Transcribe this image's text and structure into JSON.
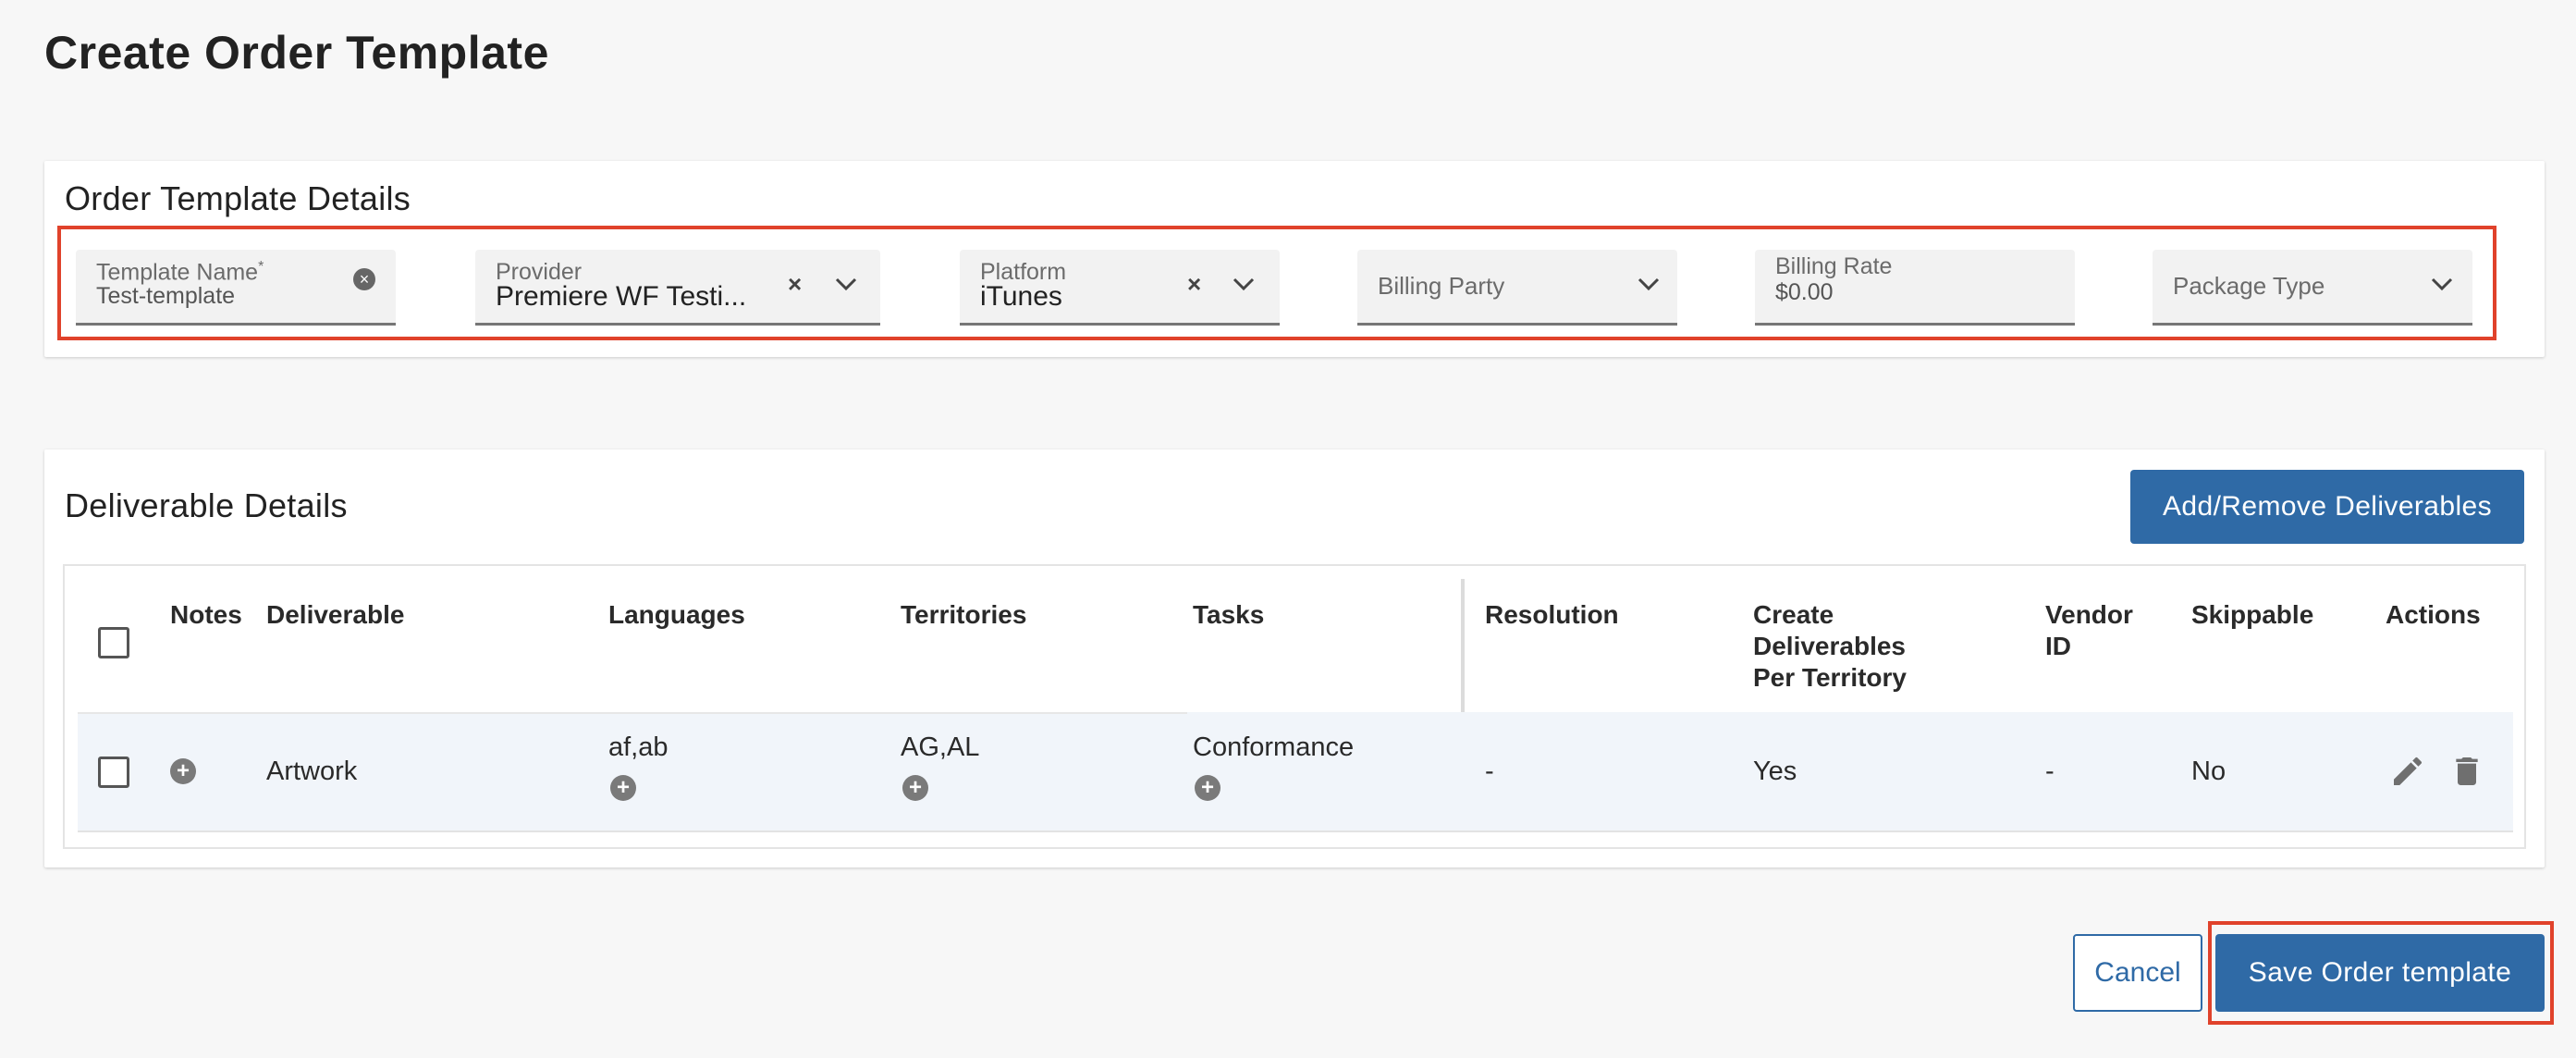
{
  "page": {
    "title": "Create Order Template"
  },
  "details": {
    "title": "Order Template Details",
    "template_name": {
      "label": "Template Name",
      "required_mark": "*",
      "value": "Test-template"
    },
    "provider": {
      "label": "Provider",
      "value": "Premiere WF Testi..."
    },
    "platform": {
      "label": "Platform",
      "value": "iTunes"
    },
    "billing_party": {
      "placeholder": "Billing Party"
    },
    "billing_rate": {
      "label": "Billing Rate",
      "value": "$0.00"
    },
    "package_type": {
      "placeholder": "Package Type"
    }
  },
  "deliverables": {
    "title": "Deliverable Details",
    "add_remove_label": "Add/Remove Deliverables",
    "columns": {
      "notes": "Notes",
      "deliverable": "Deliverable",
      "languages": "Languages",
      "territories": "Territories",
      "tasks": "Tasks",
      "resolution": "Resolution",
      "create_per_territory": "Create Deliverables Per Territory",
      "vendor_id": "Vendor ID",
      "skippable": "Skippable",
      "actions": "Actions"
    },
    "rows": [
      {
        "deliverable": "Artwork",
        "languages": "af,ab",
        "territories": "AG,AL",
        "tasks": "Conformance",
        "resolution": "-",
        "create_per_territory": "Yes",
        "vendor_id": "-",
        "skippable": "No"
      }
    ]
  },
  "footer": {
    "cancel_label": "Cancel",
    "save_label": "Save Order template"
  },
  "colors": {
    "primary": "#2f6aa6",
    "highlight": "#e0422b"
  }
}
